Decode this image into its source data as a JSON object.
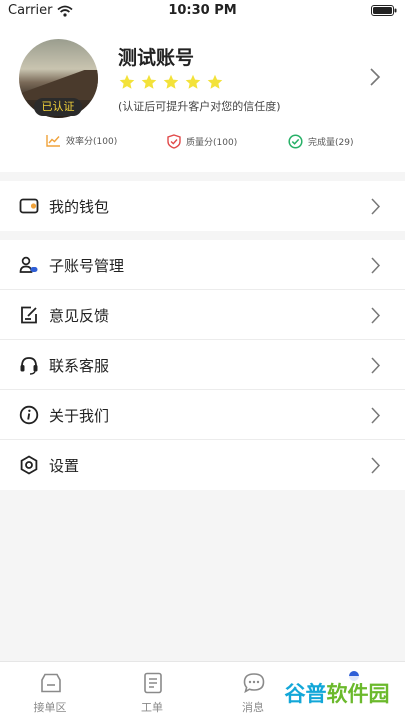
{
  "status_bar": {
    "carrier": "Carrier",
    "time": "10:30 PM"
  },
  "profile": {
    "name": "测试账号",
    "badge": "已认证",
    "star_count": 5,
    "star_color": "#f3e23a",
    "hint": "(认证后可提升客户对您的信任度)"
  },
  "metrics": [
    {
      "label": "效率分(100)",
      "icon": "chart-line-icon",
      "color": "#f0a23a"
    },
    {
      "label": "质量分(100)",
      "icon": "shield-check-icon",
      "color": "#e14a4a"
    },
    {
      "label": "完成量(29)",
      "icon": "check-circle-icon",
      "color": "#27b067"
    }
  ],
  "menu": {
    "wallet": "我的钱包",
    "sub_accounts": "子账号管理",
    "feedback": "意见反馈",
    "customer_service": "联系客服",
    "about": "关于我们",
    "settings": "设置"
  },
  "tabs": [
    {
      "label": "接单区",
      "icon": "inbox-icon"
    },
    {
      "label": "工单",
      "icon": "document-icon"
    },
    {
      "label": "消息",
      "icon": "chat-icon"
    }
  ],
  "watermark": {
    "part1": "谷普",
    "part2": "软件园"
  }
}
